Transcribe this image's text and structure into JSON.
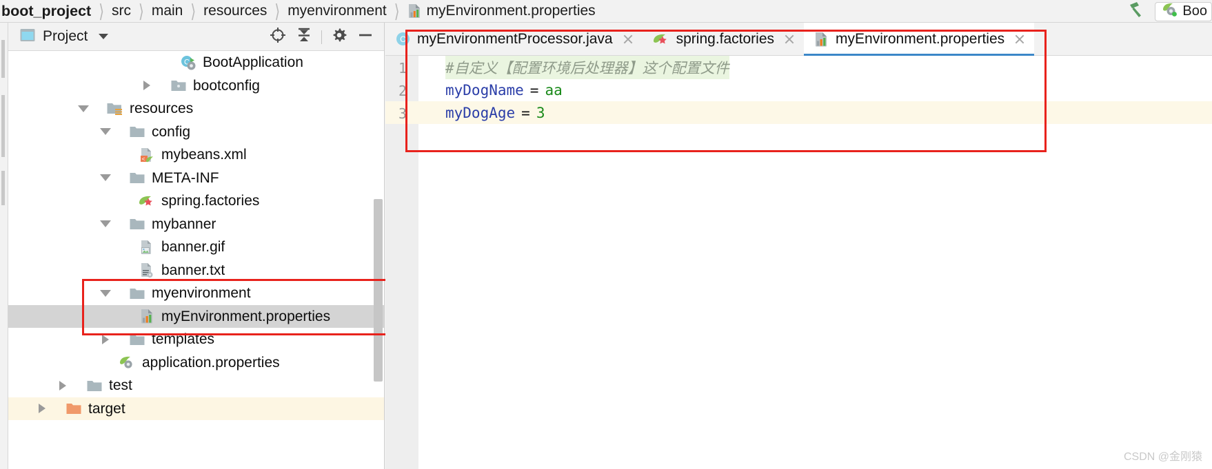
{
  "breadcrumb": {
    "items": [
      {
        "label": "boot_project",
        "icon": "none",
        "root": true
      },
      {
        "label": "src",
        "icon": "none"
      },
      {
        "label": "main",
        "icon": "none"
      },
      {
        "label": "resources",
        "icon": "none"
      },
      {
        "label": "myenvironment",
        "icon": "none"
      },
      {
        "label": "myEnvironment.properties",
        "icon": "properties-file-icon"
      }
    ],
    "separator": "〉"
  },
  "toolbar": {
    "build_icon": "hammer-icon",
    "run_config": {
      "icon": "spring-boot-icon",
      "label": "Boo"
    }
  },
  "project_panel": {
    "title": "Project",
    "title_icon": "project-view-icon",
    "dropdown_icon": "chevron-down-icon",
    "actions": [
      {
        "name": "select-opened-file-icon",
        "tooltip": "Select Opened File"
      },
      {
        "name": "collapse-all-icon",
        "tooltip": "Collapse All"
      },
      {
        "name": "gear-icon",
        "tooltip": "Settings"
      },
      {
        "name": "minimize-icon",
        "tooltip": "Hide"
      }
    ],
    "tree": [
      {
        "label": "BootApplication",
        "icon": "spring-boot-class-icon",
        "indent": 5,
        "twisty": "none",
        "state": "normal"
      },
      {
        "label": "bootconfig",
        "icon": "package-icon",
        "indent": 4,
        "twisty": "closed",
        "state": "normal"
      },
      {
        "label": "resources",
        "icon": "resources-folder-icon",
        "indent": 3,
        "twisty": "open",
        "state": "normal"
      },
      {
        "label": "config",
        "icon": "folder-icon",
        "indent": 4,
        "twisty": "open",
        "state": "normal"
      },
      {
        "label": "mybeans.xml",
        "icon": "spring-xml-icon",
        "indent": 5,
        "twisty": "none",
        "state": "normal"
      },
      {
        "label": "META-INF",
        "icon": "folder-icon",
        "indent": 4,
        "twisty": "open",
        "state": "normal"
      },
      {
        "label": "spring.factories",
        "icon": "spring-factories-icon",
        "indent": 5,
        "twisty": "none",
        "state": "normal"
      },
      {
        "label": "mybanner",
        "icon": "folder-icon",
        "indent": 4,
        "twisty": "open",
        "state": "normal"
      },
      {
        "label": "banner.gif",
        "icon": "image-file-icon",
        "indent": 5,
        "twisty": "none",
        "state": "normal"
      },
      {
        "label": "banner.txt",
        "icon": "text-file-icon",
        "indent": 5,
        "twisty": "none",
        "state": "normal"
      },
      {
        "label": "myenvironment",
        "icon": "folder-icon",
        "indent": 4,
        "twisty": "open",
        "state": "normal"
      },
      {
        "label": "myEnvironment.properties",
        "icon": "properties-file-icon",
        "indent": 5,
        "twisty": "none",
        "state": "selected"
      },
      {
        "label": "templates",
        "icon": "folder-icon",
        "indent": 4,
        "twisty": "closed",
        "state": "normal"
      },
      {
        "label": "application.properties",
        "icon": "spring-boot-properties-icon",
        "indent": 4,
        "twisty": "none",
        "state": "normal"
      },
      {
        "label": "test",
        "icon": "folder-icon",
        "indent": 2,
        "twisty": "closed",
        "state": "normal"
      },
      {
        "label": "target",
        "icon": "target-folder-icon",
        "indent": 1,
        "twisty": "closed",
        "state": "target-highlight"
      }
    ]
  },
  "editor": {
    "tabs": [
      {
        "label": "myEnvironmentProcessor.java",
        "icon": "java-class-icon",
        "active": false,
        "closable": true
      },
      {
        "label": "spring.factories",
        "icon": "spring-factories-icon",
        "active": false,
        "closable": true
      },
      {
        "label": "myEnvironment.properties",
        "icon": "properties-file-icon",
        "active": true,
        "closable": true
      }
    ],
    "lines": [
      {
        "number": "1",
        "type": "comment",
        "text": "#自定义【配置环境后处理器】这个配置文件",
        "current": false
      },
      {
        "number": "2",
        "type": "property",
        "key": "myDogName",
        "eq": "=",
        "value": "aa",
        "current": false
      },
      {
        "number": "3",
        "type": "property",
        "key": "myDogAge",
        "eq": "=",
        "value": "3",
        "current": true
      }
    ]
  },
  "annotations": {
    "editor_box_color": "#e8221c",
    "tree_box_color": "#e8221c"
  },
  "watermark": "CSDN @金刚猿"
}
